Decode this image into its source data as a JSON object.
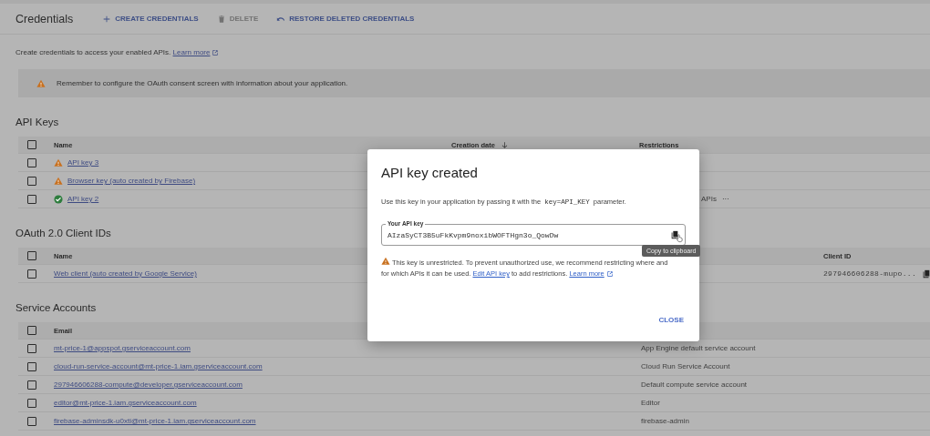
{
  "header": {
    "title": "Credentials",
    "actions": [
      {
        "label": "CREATE CREDENTIALS",
        "disabled": false
      },
      {
        "label": "DELETE",
        "disabled": true
      },
      {
        "label": "RESTORE DELETED CREDENTIALS",
        "disabled": false
      }
    ]
  },
  "intro": {
    "text": "Create credentials to access your enabled APIs.",
    "link": "Learn more"
  },
  "banner": {
    "text": "Remember to configure the OAuth consent screen with information about your application."
  },
  "sections": [
    {
      "kind": "api_keys",
      "title": "API Keys",
      "header_checked": false,
      "columns": [
        {
          "label": "Name",
          "sorted": false
        },
        {
          "label": "Creation date",
          "sorted": true
        },
        {
          "label": "Restrictions",
          "sorted": false
        }
      ],
      "rows": [
        {
          "checked": false,
          "kind": "warning",
          "name": "API key 3"
        },
        {
          "checked": false,
          "kind": "warning",
          "name": "Browser key (auto created by Firebase)"
        },
        {
          "checked": false,
          "kind": "ok",
          "name": "API key 2",
          "restrictions": "APIs",
          "more": "···"
        }
      ]
    },
    {
      "kind": "oauth",
      "title": "OAuth 2.0 Client IDs",
      "header_checked": false,
      "columns": [
        {
          "label": "Name",
          "sorted": false
        },
        {
          "label": "Client ID",
          "sorted": false
        }
      ],
      "rows": [
        {
          "checked": false,
          "name": "Web client (auto created by Google Service)",
          "client_id": "297946606288-mupo..."
        }
      ]
    },
    {
      "kind": "service_accounts",
      "title": "Service Accounts",
      "header_checked": false,
      "columns": [
        {
          "label": "Email",
          "sorted": false
        }
      ],
      "rows": [
        {
          "checked": false,
          "name": "mt-price-1@appspot.gserviceaccount.com",
          "account_name": "App Engine default service account"
        },
        {
          "checked": false,
          "name": "cloud-run-service-account@mt-price-1.iam.gserviceaccount.com",
          "account_name": "Cloud Run Service Account"
        },
        {
          "checked": false,
          "name": "297946606288-compute@developer.gserviceaccount.com",
          "account_name": "Default compute service account"
        },
        {
          "checked": false,
          "name": "editor@mt-price-1.iam.gserviceaccount.com",
          "account_name": "Editor"
        },
        {
          "checked": false,
          "name": "firebase-adminsdk-u0xti@mt-price-1.iam.gserviceaccount.com",
          "account_name": "firebase-admin"
        }
      ]
    }
  ],
  "dialog": {
    "title": "API key created",
    "description": {
      "before": "Use this key in your application by passing it with the",
      "code": "key=API_KEY",
      "after": "parameter."
    },
    "field": {
      "label": "Your API key",
      "value": "AIzaSyCT3B5uFkKvpm9noxibWOFTHgn3o_QowDw"
    },
    "tooltip": "Copy to clipboard",
    "warning": {
      "text": "This key is unrestricted. To prevent unauthorized use, we recommend restricting where and for which APIs it can be used.",
      "link": "Edit API key",
      "after": "to add restrictions.",
      "learn_more": "Learn more"
    },
    "button": "CLOSE"
  }
}
